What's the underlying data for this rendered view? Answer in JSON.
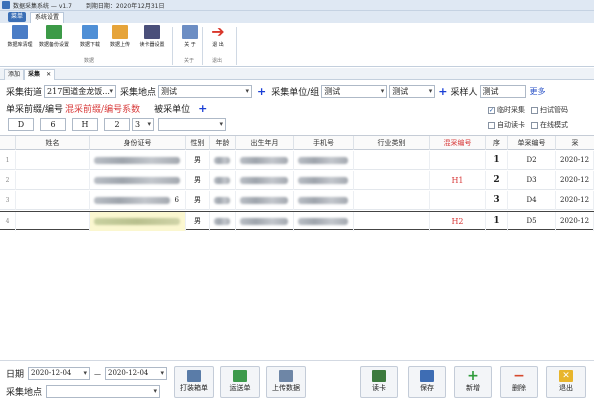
{
  "titlebar": {
    "app_title": "数据采集系统 — v1.7",
    "expiry": "到期日期：2020年12月31日"
  },
  "ribbon": {
    "menu_label": "系统设置",
    "quick_label": "菜单",
    "buttons": [
      {
        "label": "数据库清理",
        "color": "#4b7dc6"
      },
      {
        "label": "数据备份设置",
        "color": "#3c9a47"
      },
      {
        "label": "数据下载",
        "color": "#4f8fd6"
      },
      {
        "label": "数据上传",
        "color": "#e6a43a"
      },
      {
        "label": "读卡器设置",
        "color": "#4a4f7a"
      },
      {
        "label": "关 于",
        "color": "#6d8ec4"
      },
      {
        "label": "退 出",
        "color": "#d9362a"
      }
    ],
    "group_labels": [
      "数据",
      "关于",
      "退出"
    ]
  },
  "doc_tabs": {
    "tab1": "添加",
    "tab2": "采集",
    "close": "✕"
  },
  "form": {
    "street_label": "采集街道",
    "street_value": "217国道金龙饭...",
    "site_label": "采集地点",
    "site_value": "测试",
    "unit_group_label": "采集单位/组",
    "unit_group_value": "测试",
    "unit_group_value2": "测试",
    "collector_label": "采样人",
    "collector_value": "测试",
    "more": "更多",
    "prefix_label": "单采前缀/编号",
    "mixed_label": "混采前缀/编号系数",
    "sampled_unit_label": "被采单位",
    "sampled_unit_value": "",
    "prefix_fields": [
      "D",
      "6",
      "H",
      "2",
      "3"
    ],
    "checks": [
      {
        "label": "临时采集",
        "checked": true
      },
      {
        "label": "扫试管码",
        "checked": false
      },
      {
        "label": "自动读卡",
        "checked": false
      },
      {
        "label": "在线模式",
        "checked": false
      }
    ]
  },
  "table": {
    "headers": [
      "姓名",
      "身份证号",
      "性别",
      "年龄",
      "出生年月",
      "手机号",
      "行业类别",
      "混采编号",
      "序",
      "单采编号",
      "采"
    ],
    "rows": [
      {
        "num": "1",
        "id_tail": "",
        "gender": "男",
        "mixed": "",
        "seq": "1",
        "single": "D2",
        "date": "2020-12"
      },
      {
        "num": "2",
        "id_tail": "",
        "gender": "男",
        "mixed": "H1",
        "seq": "2",
        "single": "D3",
        "date": "2020-12"
      },
      {
        "num": "3",
        "id_tail": "6",
        "gender": "男",
        "mixed": "",
        "seq": "3",
        "single": "D4",
        "date": "2020-12"
      },
      {
        "num": "4",
        "id_tail": "",
        "gender": "男",
        "mixed": "H2",
        "seq": "1",
        "single": "D5",
        "date": "2020-12"
      }
    ]
  },
  "bottom": {
    "date_label": "日期",
    "date_from": "2020-12-04",
    "date_sep": "—",
    "date_to": "2020-12-04",
    "site_label": "采集地点",
    "site_value": "",
    "buttons": [
      {
        "label": "打装箱单",
        "color": "#5a7ca8"
      },
      {
        "label": "运送单",
        "color": "#3d9a4c"
      },
      {
        "label": "上传数据",
        "color": "#6e86a6"
      },
      {
        "label": "读卡",
        "color": "#3c7a3e"
      },
      {
        "label": "保存",
        "color": "#3e6db4"
      },
      {
        "label": "新增",
        "color": "#2e9b3a"
      },
      {
        "label": "删除",
        "color": "#d64a2e"
      },
      {
        "label": "退出",
        "color": "#e8b52c"
      }
    ]
  }
}
